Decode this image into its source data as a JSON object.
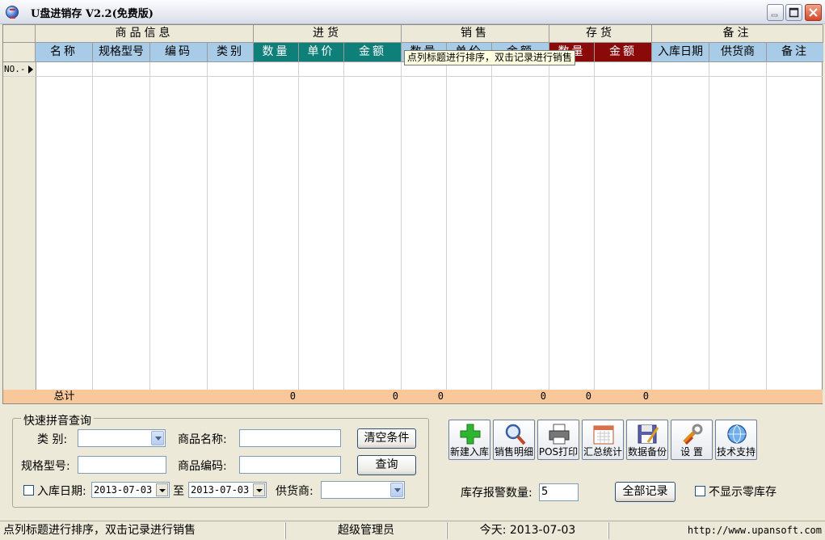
{
  "window": {
    "title": "U盘进销存 V2.2(免费版)",
    "controls": [
      "minimize-icon",
      "maximize-icon",
      "close-icon"
    ]
  },
  "grid": {
    "groups": [
      {
        "label": "商品信息"
      },
      {
        "label": "进货"
      },
      {
        "label": "销售"
      },
      {
        "label": "存货"
      },
      {
        "label": "备注"
      }
    ],
    "columns": [
      {
        "label": "名称"
      },
      {
        "label": "规格型号"
      },
      {
        "label": "编码"
      },
      {
        "label": "类别"
      },
      {
        "label": "数量"
      },
      {
        "label": "单价"
      },
      {
        "label": "金额"
      },
      {
        "label": "数量"
      },
      {
        "label": "单价"
      },
      {
        "label": "金额"
      },
      {
        "label": "数量"
      },
      {
        "label": "金额"
      },
      {
        "label": "入库日期"
      },
      {
        "label": "供货商"
      },
      {
        "label": "备注"
      }
    ],
    "row_indicator": "NO.-",
    "tooltip": "点列标题进行排序，双击记录进行销售",
    "totals": {
      "label": "总计",
      "purchase_qty": "0",
      "purchase_amount": "0",
      "sales_qty": "0",
      "sales_amount": "0",
      "stock_qty": "0",
      "stock_amount": "0"
    },
    "colors": {
      "purchase_header": "#0f7f7a",
      "stock_header": "#8a0a0a",
      "column_header": "#a8cbe8",
      "totals_row": "#f9c89a"
    }
  },
  "search": {
    "title": "快速拼音查询",
    "category_label": "类 别:",
    "category_value": "",
    "name_label": "商品名称:",
    "name_value": "",
    "spec_label": "规格型号:",
    "spec_value": "",
    "code_label": "商品编码:",
    "code_value": "",
    "date_label": "入库日期:",
    "date_from": "2013-07-03",
    "date_to_label": "至",
    "date_to": "2013-07-03",
    "supplier_label": "供货商:",
    "supplier_value": "",
    "clear_button": "清空条件",
    "query_button": "查询"
  },
  "toolbar": {
    "buttons": [
      {
        "label": "新建入库",
        "icon": "plus-icon"
      },
      {
        "label": "销售明细",
        "icon": "magnifier-icon"
      },
      {
        "label": "POS打印",
        "icon": "printer-icon"
      },
      {
        "label": "汇总统计",
        "icon": "calendar-icon"
      },
      {
        "label": "数据备份",
        "icon": "floppy-icon"
      },
      {
        "label": "设 置",
        "icon": "tools-icon"
      },
      {
        "label": "技术支持",
        "icon": "globe-icon"
      }
    ]
  },
  "stock_alert": {
    "label": "库存报警数量:",
    "value": "5",
    "all_records_button": "全部记录",
    "hide_zero_label": "不显示零库存"
  },
  "statusbar": {
    "hint": "点列标题进行排序，双击记录进行销售",
    "user": "超级管理员",
    "today": "今天: 2013-07-03",
    "website": "http://www.upansoft.com"
  }
}
